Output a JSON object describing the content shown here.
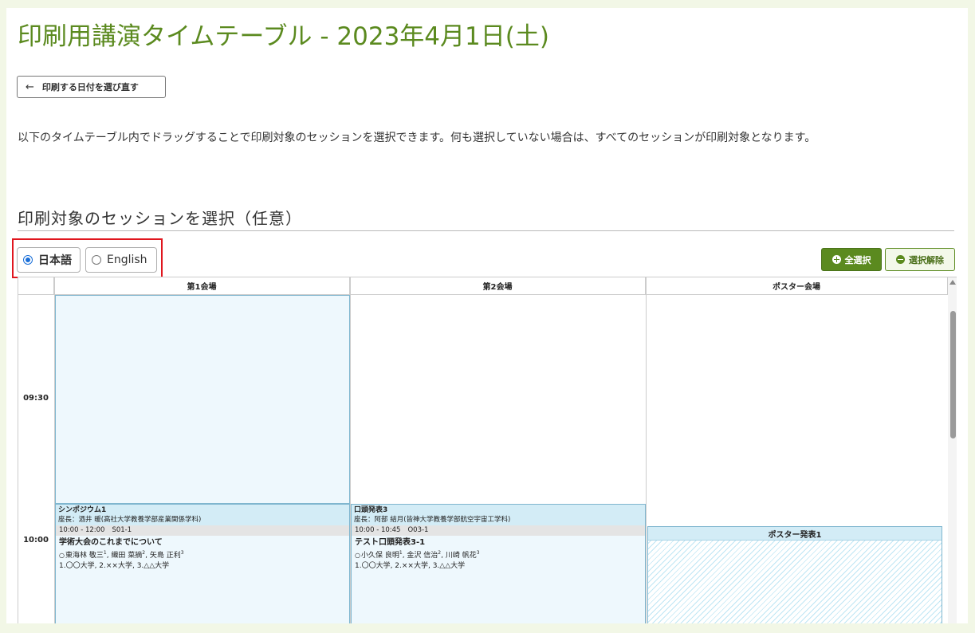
{
  "title": "印刷用講演タイムテーブル - 2023年4月1日(土)",
  "back_button": "印刷する日付を選び直す",
  "description": "以下のタイムテーブル内でドラッグすることで印刷対象のセッションを選択できます。何も選択していない場合は、すべてのセッションが印刷対象となります。",
  "section_heading": "印刷対象のセッションを選択（任意）",
  "language": {
    "options": [
      "日本語",
      "English"
    ],
    "selected": "日本語"
  },
  "buttons": {
    "select_all": "全選択",
    "clear_selection": "選択解除"
  },
  "timetable": {
    "venues": [
      "第1会場",
      "第2会場",
      "ポスター会場"
    ],
    "times": [
      "09:30",
      "10:00"
    ],
    "sessions": [
      {
        "name": "シンポジウム1",
        "chair": "座長：酒井 暖(高社大学教養学部産業関係学科)",
        "time": "10:00 - 12:00",
        "code": "S01-1",
        "talk_title": "学術大会のこれまでについて",
        "presenter_mark": "○",
        "authors": [
          {
            "name": "東海林 敬三",
            "aff": "1"
          },
          {
            "name": "織田 菜摘",
            "aff": "2"
          },
          {
            "name": "矢島 正利",
            "aff": "3"
          }
        ],
        "affiliations": "1.〇〇大学, 2.××大学, 3.△△大学"
      },
      {
        "name": "口頭発表3",
        "chair": "座長：阿部 結月(皆神大学教養学部航空宇宙工学科)",
        "time": "10:00 - 10:45",
        "code": "O03-1",
        "talk_title": "テスト口頭発表3-1",
        "presenter_mark": "○",
        "authors": [
          {
            "name": "小久保 良明",
            "aff": "1"
          },
          {
            "name": "金沢 信治",
            "aff": "2"
          },
          {
            "name": "川崎 帆花",
            "aff": "3"
          }
        ],
        "affiliations": "1.〇〇大学, 2.××大学, 3.△△大学"
      }
    ],
    "poster_session": "ポスター発表1"
  },
  "colors": {
    "accent": "#5b8a1f",
    "highlight": "#e0161e",
    "session_bg": "#eef8fd"
  },
  "icons": {
    "back": "arrow-left-icon",
    "select_all": "plus-circle-icon",
    "clear": "minus-circle-icon"
  }
}
